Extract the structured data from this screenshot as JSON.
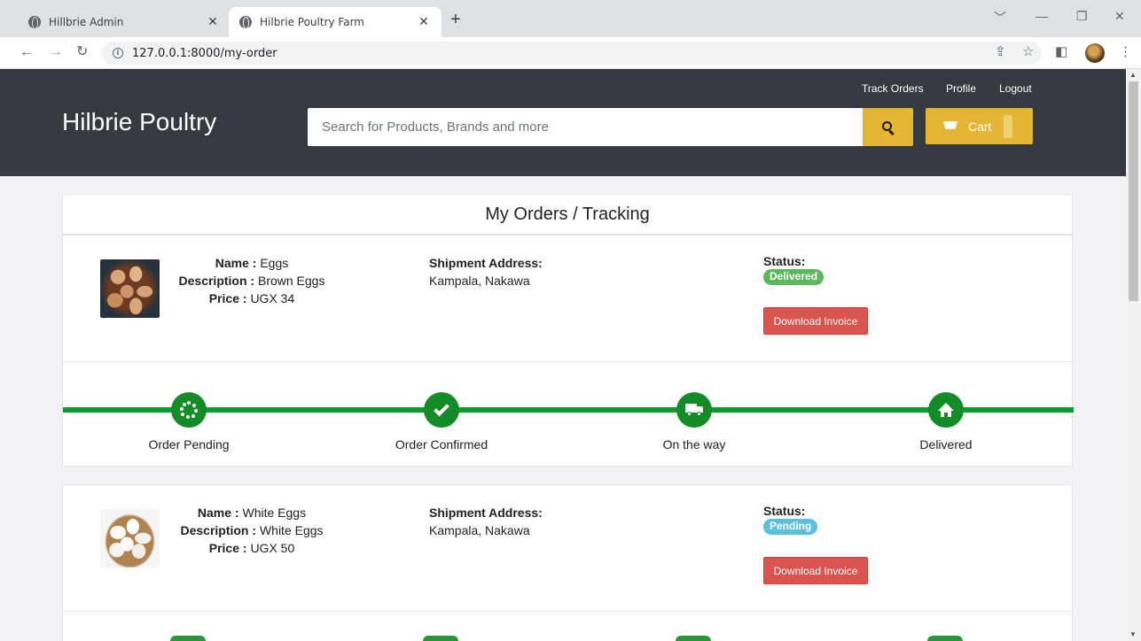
{
  "browser": {
    "tabs": [
      {
        "title": "Hillbrie Admin",
        "active": false
      },
      {
        "title": "Hilbrie Poultry Farm",
        "active": true
      }
    ],
    "url": "127.0.0.1:8000/my-order"
  },
  "site": {
    "brand": "Hilbrie Poultry",
    "nav": {
      "track_orders": "Track Orders",
      "profile": "Profile",
      "logout": "Logout"
    },
    "search": {
      "placeholder": "Search for Products, Brands and more"
    },
    "cart_label": "Cart"
  },
  "page": {
    "title": "My Orders / Tracking",
    "labels": {
      "name": "Name :",
      "description": "Description :",
      "price": "Price :",
      "shipment": "Shipment Address:",
      "status": "Status:",
      "invoice": "Download Invoice"
    },
    "tracking_steps": [
      "Order Pending",
      "Order Confirmed",
      "On the way",
      "Delivered"
    ],
    "orders": [
      {
        "name": "Eggs",
        "description": "Brown Eggs",
        "price": "UGX 34",
        "address": "Kampala, Nakawa",
        "status": "Delivered",
        "status_color": "#5cb85c"
      },
      {
        "name": "White Eggs",
        "description": "White Eggs",
        "price": "UGX 50",
        "address": "Kampala, Nakawa",
        "status": "Pending",
        "status_color": "#5bc0de"
      }
    ]
  },
  "colors": {
    "header_bg": "#343a40",
    "accent_yellow": "#e5b536",
    "progress_green": "#0b9a2d",
    "invoice_red": "#d9534f"
  }
}
